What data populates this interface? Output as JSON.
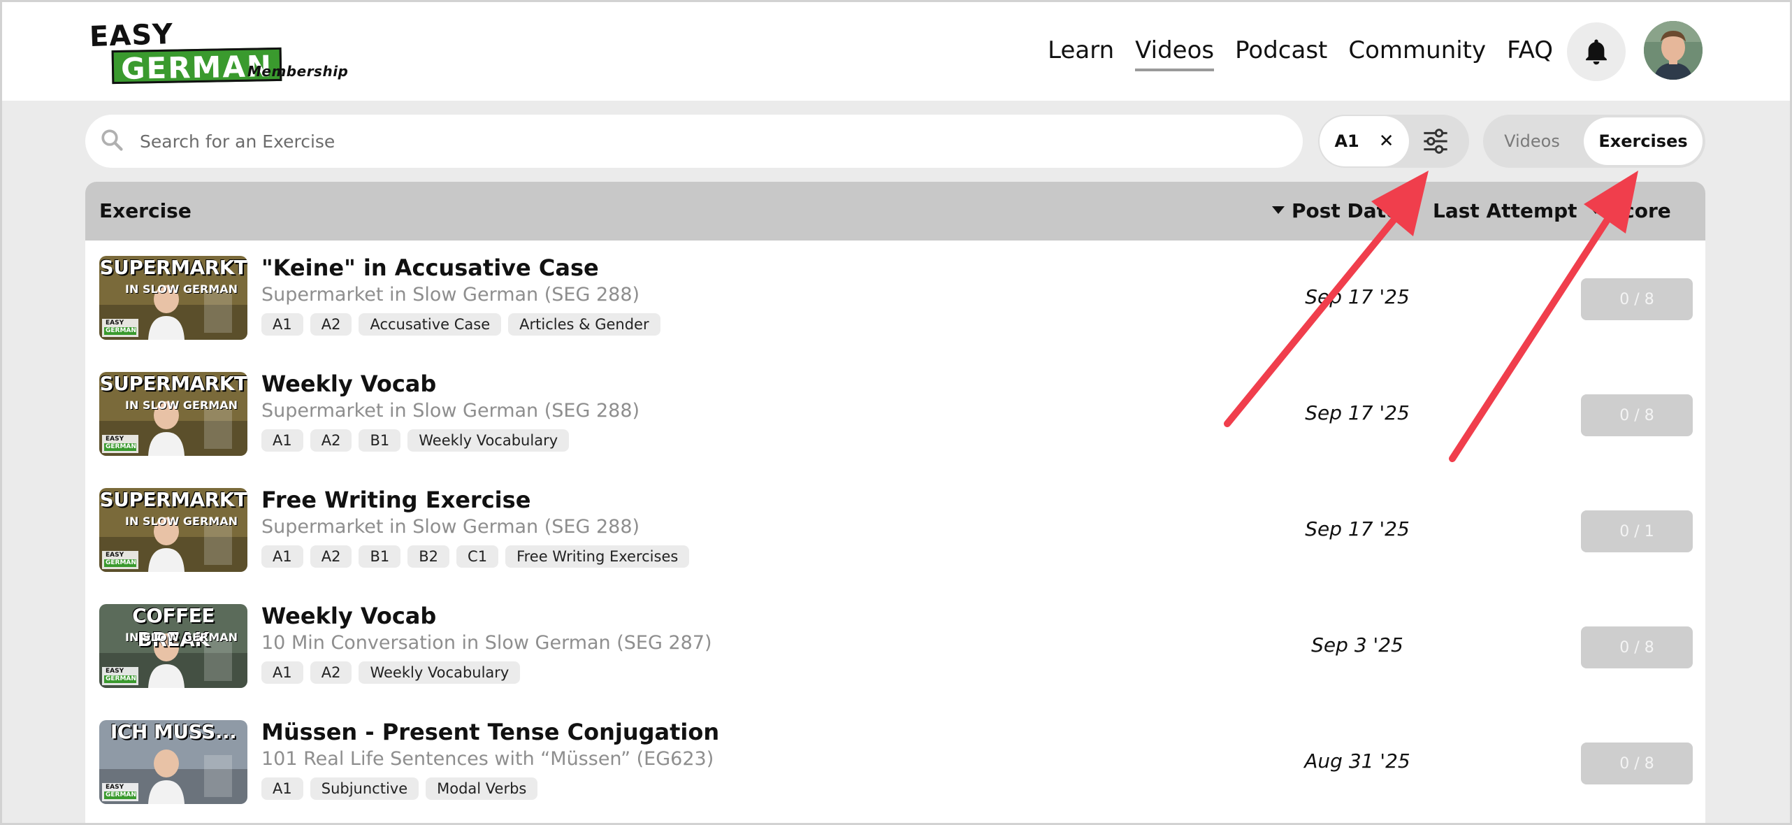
{
  "logo": {
    "easy": "EASY",
    "german": "GERMAN",
    "membership": "Membership"
  },
  "nav": {
    "items": [
      {
        "label": "Learn",
        "active": false
      },
      {
        "label": "Videos",
        "active": true
      },
      {
        "label": "Podcast",
        "active": false
      },
      {
        "label": "Community",
        "active": false
      },
      {
        "label": "FAQ",
        "active": false
      }
    ],
    "bell_icon": "bell-icon",
    "avatar": "user-avatar"
  },
  "search": {
    "placeholder": "Search for an Exercise",
    "value": ""
  },
  "filter": {
    "chip_label": "A1",
    "remove_icon": "close-icon",
    "settings_icon": "sliders-icon"
  },
  "view_toggle": {
    "videos_label": "Videos",
    "exercises_label": "Exercises",
    "selected": "Exercises"
  },
  "table": {
    "headers": {
      "exercise": "Exercise",
      "post_date": "Post Date",
      "last_attempt": "Last Attempt",
      "score": "Score"
    },
    "rows": [
      {
        "title": "\"Keine\" in Accusative Case",
        "subtitle": "Supermarket in Slow German (SEG 288)",
        "tags": [
          "A1",
          "A2",
          "Accusative Case",
          "Articles & Gender"
        ],
        "post_date": "Sep 17 '25",
        "score": "0 / 8",
        "thumb": {
          "headline": "SUPERMARKT",
          "sub": "IN SLOW GERMAN",
          "badge_top": "EASY",
          "badge_bottom": "GERMAN",
          "bg": "#7a6a3a"
        }
      },
      {
        "title": "Weekly Vocab",
        "subtitle": "Supermarket in Slow German (SEG 288)",
        "tags": [
          "A1",
          "A2",
          "B1",
          "Weekly Vocabulary"
        ],
        "post_date": "Sep 17 '25",
        "score": "0 / 8",
        "thumb": {
          "headline": "SUPERMARKT",
          "sub": "IN SLOW GERMAN",
          "badge_top": "EASY",
          "badge_bottom": "GERMAN",
          "bg": "#7a6a3a"
        }
      },
      {
        "title": "Free Writing Exercise",
        "subtitle": "Supermarket in Slow German (SEG 288)",
        "tags": [
          "A1",
          "A2",
          "B1",
          "B2",
          "C1",
          "Free Writing Exercises"
        ],
        "post_date": "Sep 17 '25",
        "score": "0 / 1",
        "thumb": {
          "headline": "SUPERMARKT",
          "sub": "IN SLOW GERMAN",
          "badge_top": "EASY",
          "badge_bottom": "GERMAN",
          "bg": "#7a6a3a"
        }
      },
      {
        "title": "Weekly Vocab",
        "subtitle": "10 Min Conversation in Slow German (SEG 287)",
        "tags": [
          "A1",
          "A2",
          "Weekly Vocabulary"
        ],
        "post_date": "Sep 3 '25",
        "score": "0 / 8",
        "thumb": {
          "headline": "COFFEE BREAK",
          "sub": "IN SLOW GERMAN",
          "badge_top": "EASY",
          "badge_bottom": "GERMAN",
          "bg": "#5b6b5a"
        }
      },
      {
        "title": "Müssen - Present Tense Conjugation",
        "subtitle": "101 Real Life Sentences with “Müssen” (EG623)",
        "tags": [
          "A1",
          "Subjunctive",
          "Modal Verbs"
        ],
        "post_date": "Aug 31 '25",
        "score": "0 / 8",
        "thumb": {
          "headline": "ICH MUSS...",
          "sub": "",
          "badge_top": "EASY",
          "badge_bottom": "GERMAN",
          "bg": "#8f9aa6"
        }
      }
    ]
  },
  "colors": {
    "brand_green": "#3a9a2e",
    "arrow_red": "#f03e4c",
    "header_gray": "#c8c8c8",
    "score_gray": "#cecece"
  }
}
